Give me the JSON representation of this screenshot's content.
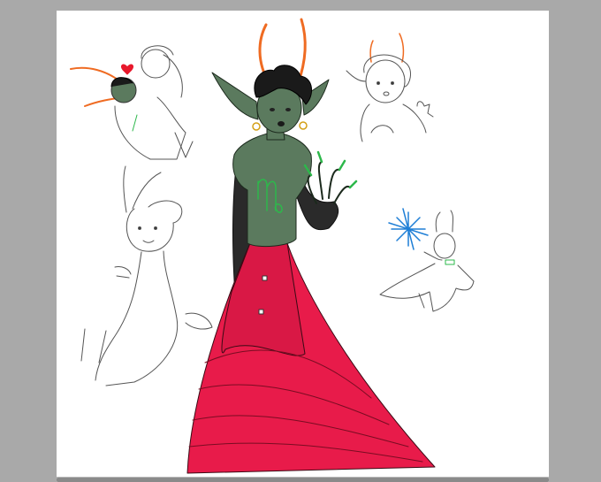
{
  "canvas": {
    "background_color": "#a9a9a9",
    "paper_color": "#ffffff"
  },
  "artwork": {
    "figures": [
      {
        "name": "main-troll-figure",
        "skin": "#5b7a5e",
        "horn": "#ef6b22",
        "dress": "#e81b4a",
        "dress_shadow": "#c0123a",
        "accent": "#2db84b"
      },
      {
        "name": "sketch-hug-pair",
        "horn": "#ef6b22",
        "accent": "#2db84b"
      },
      {
        "name": "sketch-curly-troll-waving",
        "horn": "#ef6b22"
      },
      {
        "name": "sketch-lounging-troll"
      },
      {
        "name": "sketch-small-troll-sparkle",
        "sparkle": "#1f7fd6",
        "accent": "#2db84b"
      }
    ],
    "symbol": "virgo-sign",
    "heart_color": "#e8192c"
  },
  "scrollbar": {
    "orientation": "horizontal"
  }
}
